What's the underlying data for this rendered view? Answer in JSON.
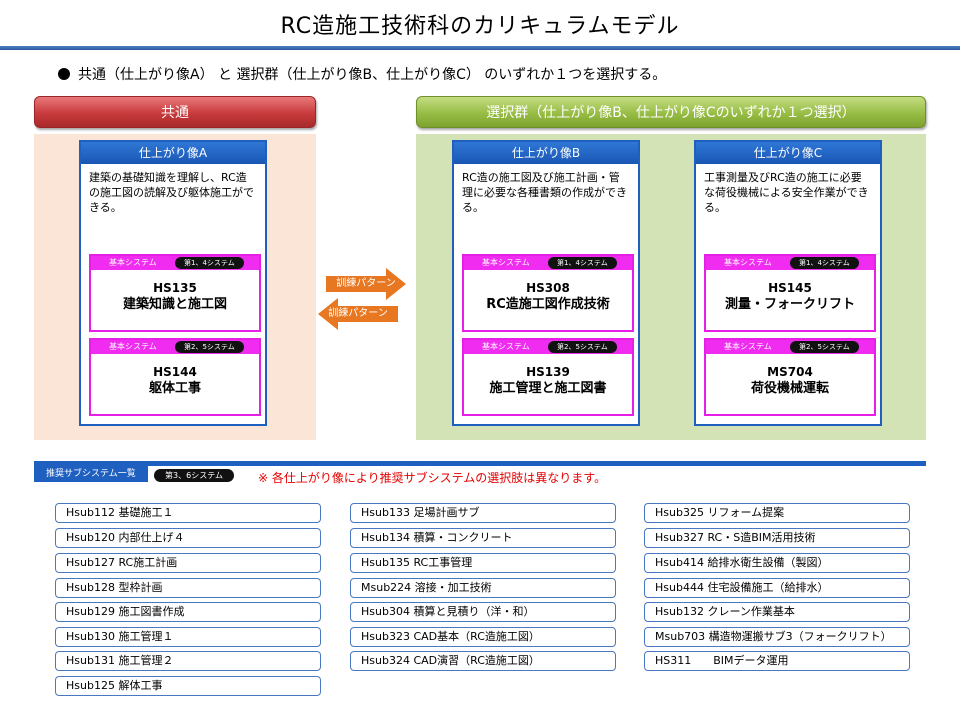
{
  "title": "RC造施工技術科のカリキュラムモデル",
  "intro": "共通（仕上がり像A） と 選択群（仕上がり像B、仕上がり像C） のいずれか１つを選択する。",
  "common_header": "共通",
  "select_header": "選択群（仕上がり像B、仕上がり像Cのいずれか１つ選択）",
  "arrows": {
    "right": "訓練パターン",
    "left": "訓練パターン"
  },
  "cards": [
    {
      "title": "仕上がり像A",
      "desc": "建築の基礎知識を理解し、RC造の施工図の読解及び躯体施工ができる。",
      "systems": [
        {
          "bar": "基本システム",
          "tag": "第1、4システム",
          "code": "HS135",
          "name": "建築知識と施工図"
        },
        {
          "bar": "基本システム",
          "tag": "第2、5システム",
          "code": "HS144",
          "name": "躯体工事"
        }
      ]
    },
    {
      "title": "仕上がり像B",
      "desc": "RC造の施工図及び施工計画・管理に必要な各種書類の作成ができる。",
      "systems": [
        {
          "bar": "基本システム",
          "tag": "第1、4システム",
          "code": "HS308",
          "name": "RC造施工図作成技術"
        },
        {
          "bar": "基本システム",
          "tag": "第2、5システム",
          "code": "HS139",
          "name": "施工管理と施工図書"
        }
      ]
    },
    {
      "title": "仕上がり像C",
      "desc": "工事測量及びRC造の施工に必要な荷役機械による安全作業ができる。",
      "systems": [
        {
          "bar": "基本システム",
          "tag": "第1、4システム",
          "code": "HS145",
          "name": "測量・フォークリフト"
        },
        {
          "bar": "基本システム",
          "tag": "第2、5システム",
          "code": "MS704",
          "name": "荷役機械運転"
        }
      ]
    }
  ],
  "subsystems": {
    "label": "推奨サブシステム一覧",
    "tag": "第3、6システム",
    "note": "※ 各仕上がり像により推奨サブシステムの選択肢は異なります。",
    "columns": [
      [
        "Hsub112 基礎施工１",
        "Hsub120 内部仕上げ４",
        "Hsub127 RC施工計画",
        "Hsub128 型枠計画",
        "Hsub129 施工図書作成",
        "Hsub130 施工管理１",
        "Hsub131 施工管理２",
        "Hsub125 解体工事"
      ],
      [
        "Hsub133 足場計画サブ",
        "Hsub134 積算・コンクリート",
        "Hsub135 RC工事管理",
        "Msub224 溶接・加工技術",
        "Hsub304 積算と見積り（洋・和）",
        "Hsub323 CAD基本（RC造施工図）",
        "Hsub324 CAD演習（RC造施工図）"
      ],
      [
        "Hsub325 リフォーム提案",
        "Hsub327 RC・S造BIM活用技術",
        "Hsub414 給排水衛生設備（製図）",
        "Hsub444 住宅設備施工（給排水）",
        "Hsub132 クレーン作業基本",
        "Msub703 構造物運搬サブ3（フォークリフト）",
        "HS311　　BIMデータ運用"
      ]
    ]
  },
  "colors": {
    "accent": "#1f5fbf",
    "common": "#c83a3c",
    "select": "#97bd45",
    "system": "#f02cf0",
    "arrow": "#e87722",
    "note": "#e60000"
  }
}
